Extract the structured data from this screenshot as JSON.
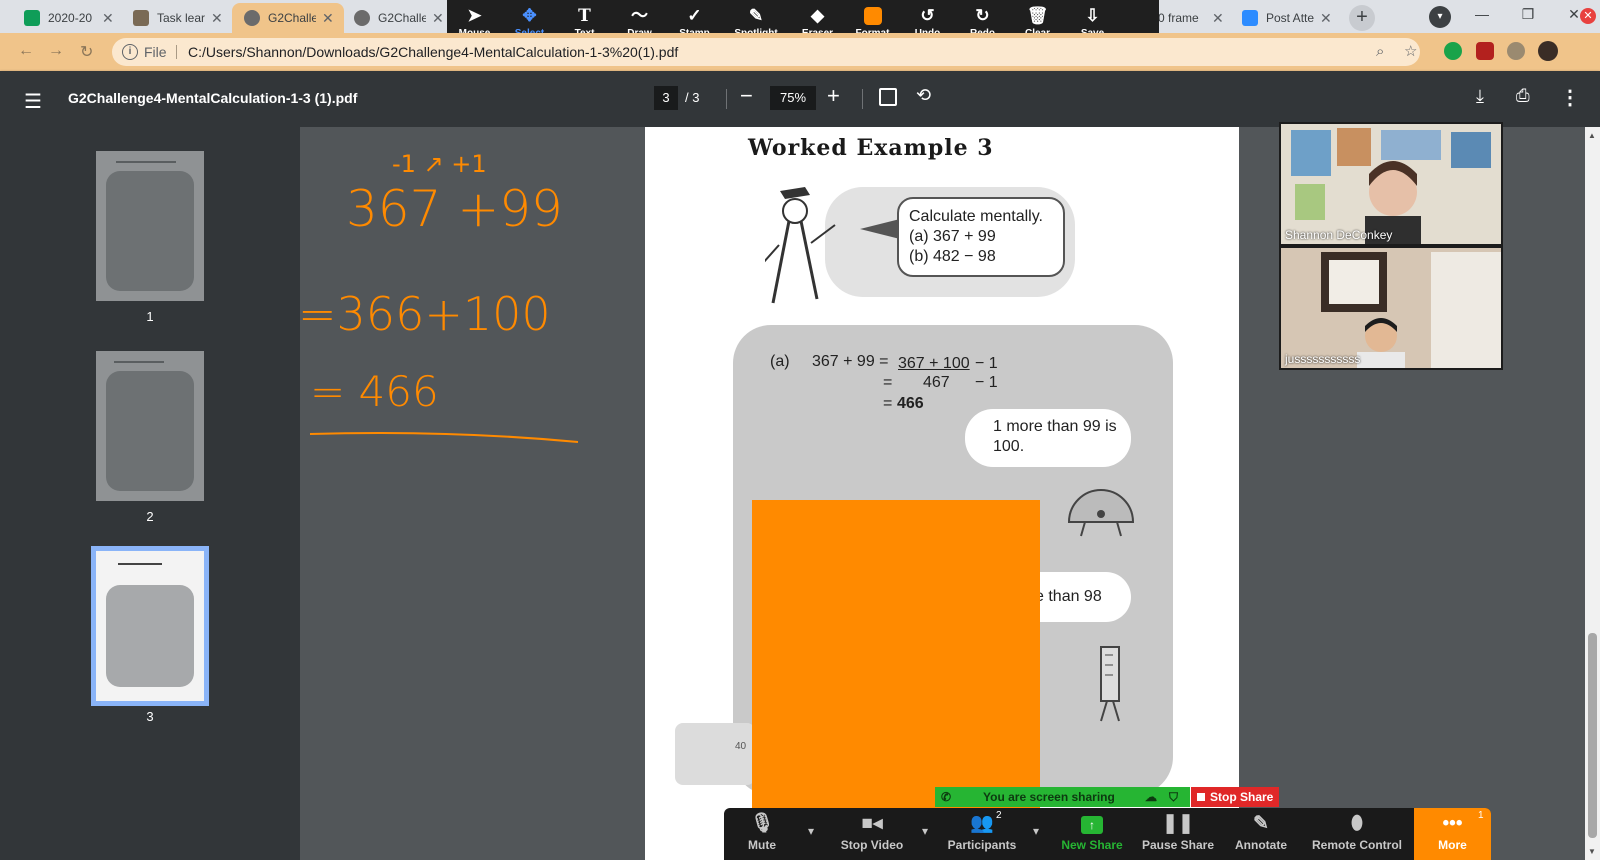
{
  "browser": {
    "tabs": [
      {
        "title": "2020-20",
        "favicon_color": "#0f9d58",
        "active": false
      },
      {
        "title": "Task lear",
        "favicon_color": "#7a6a55",
        "active": false
      },
      {
        "title": "G2Challe",
        "favicon_color": "#6b6b6b",
        "active": true
      },
      {
        "title": "G2Challe",
        "favicon_color": "#6b6b6b",
        "active": false
      },
      {
        "title": "0 frame",
        "favicon_color": "#ffffff",
        "active": false
      },
      {
        "title": "Post Atte",
        "favicon_color": "#2d8cff",
        "active": false
      }
    ],
    "address": {
      "scheme_label": "File",
      "url": "C:/Users/Shannon/Downloads/G2Challenge4-MentalCalculation-1-3%20(1).pdf"
    }
  },
  "annotation_toolbar": {
    "tools": [
      {
        "label": "Mouse",
        "icon": "pointer-icon"
      },
      {
        "label": "Select",
        "icon": "move-icon",
        "selected": true
      },
      {
        "label": "Text",
        "icon": "text-icon"
      },
      {
        "label": "Draw",
        "icon": "squiggle-icon"
      },
      {
        "label": "Stamp",
        "icon": "check-icon"
      },
      {
        "label": "Spotlight",
        "icon": "wand-icon"
      },
      {
        "label": "Eraser",
        "icon": "eraser-icon"
      },
      {
        "label": "Format",
        "icon": "color-swatch-icon"
      },
      {
        "label": "Undo",
        "icon": "undo-icon"
      },
      {
        "label": "Redo",
        "icon": "redo-icon"
      },
      {
        "label": "Clear",
        "icon": "trash-icon"
      },
      {
        "label": "Save",
        "icon": "save-icon"
      }
    ],
    "accent": "#ff8a00"
  },
  "pdf_viewer": {
    "title": "G2Challenge4-MentalCalculation-1-3 (1).pdf",
    "current_page": "3",
    "page_total": "/ 3",
    "zoom": "75%",
    "thumbnails": [
      {
        "num": "1"
      },
      {
        "num": "2"
      },
      {
        "num": "3",
        "current": true
      }
    ]
  },
  "document": {
    "heading": "Worked Example 3",
    "speech_lines": [
      "Calculate mentally.",
      "(a) 367 + 99",
      "(b) 482 − 98"
    ],
    "part_label": "(a)",
    "work_line1_left": "367 + 99 =",
    "work_line1_mid": "367 + 100",
    "work_line1_right": "− 1",
    "work_line2_eq": "=",
    "work_line2_mid": "467",
    "work_line2_right": "− 1",
    "work_line3_eq": "=",
    "work_line3_val": "466",
    "hint1": "1 more than 99 is 100.",
    "hint2_partial": "e than 98",
    "page_number_partial": "40"
  },
  "handwriting": {
    "line1_top": "-1  ↗  +1",
    "line1": "367 +99",
    "line2": "=366+100",
    "line3": "= 466",
    "ink_color": "#ff8a00"
  },
  "participants": [
    {
      "name": "Shannon DeConkey"
    },
    {
      "name": "jusssssssssss"
    }
  ],
  "zoom_share": {
    "banner": "You are screen sharing",
    "stop_share": "Stop Share",
    "buttons": [
      {
        "label": "Mute",
        "icon": "microphone-icon"
      },
      {
        "label": "Stop Video",
        "icon": "video-camera-icon"
      },
      {
        "label": "Participants",
        "icon": "participants-icon",
        "count": "2"
      },
      {
        "label": "New Share",
        "icon": "share-screen-icon"
      },
      {
        "label": "Pause Share",
        "icon": "pause-icon"
      },
      {
        "label": "Annotate",
        "icon": "pencil-icon"
      },
      {
        "label": "Remote Control",
        "icon": "mouse-icon"
      },
      {
        "label": "More",
        "icon": "ellipsis-icon",
        "count": "1"
      }
    ]
  }
}
